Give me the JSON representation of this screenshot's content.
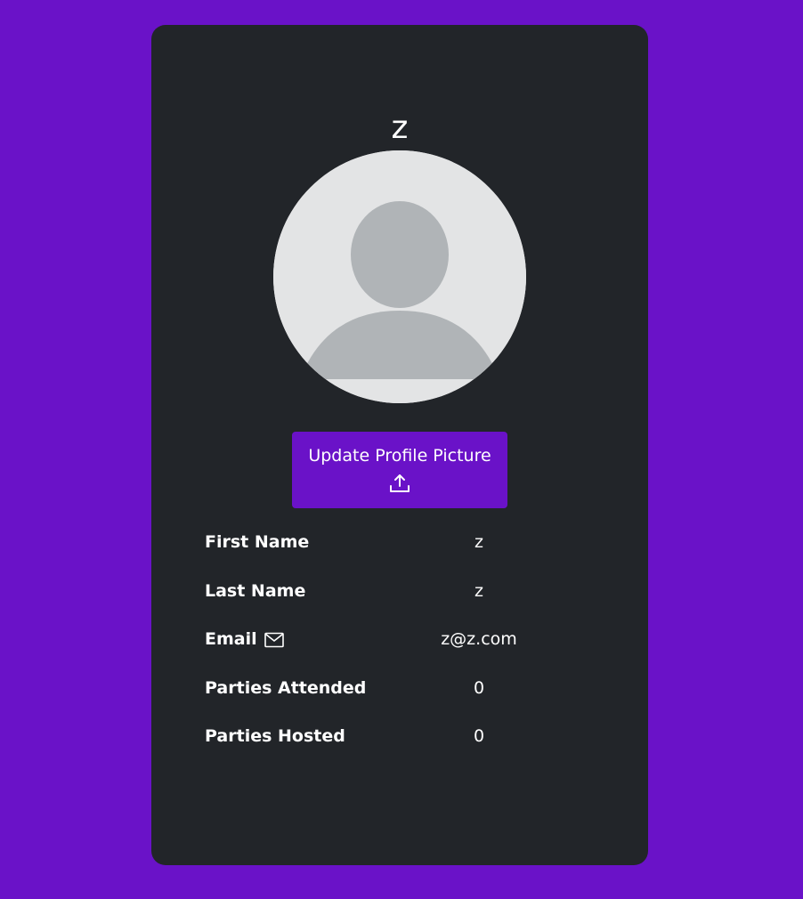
{
  "profile": {
    "username": "z",
    "avatar_icon": "default-user-avatar",
    "upload_button": {
      "label": "Update Profile Picture",
      "icon": "upload-icon"
    },
    "fields": [
      {
        "label": "First Name",
        "value": "z"
      },
      {
        "label": "Last Name",
        "value": "z"
      },
      {
        "label": "Email",
        "value": "z@z.com",
        "icon": "envelope-icon"
      },
      {
        "label": "Parties Attended",
        "value": "0"
      },
      {
        "label": "Parties Hosted",
        "value": "0"
      }
    ]
  },
  "colors": {
    "background": "#6a12c8",
    "card": "#222529",
    "accent": "#6a12c8",
    "avatar_bg": "#e3e4e5",
    "avatar_fg": "#b0b4b7"
  }
}
